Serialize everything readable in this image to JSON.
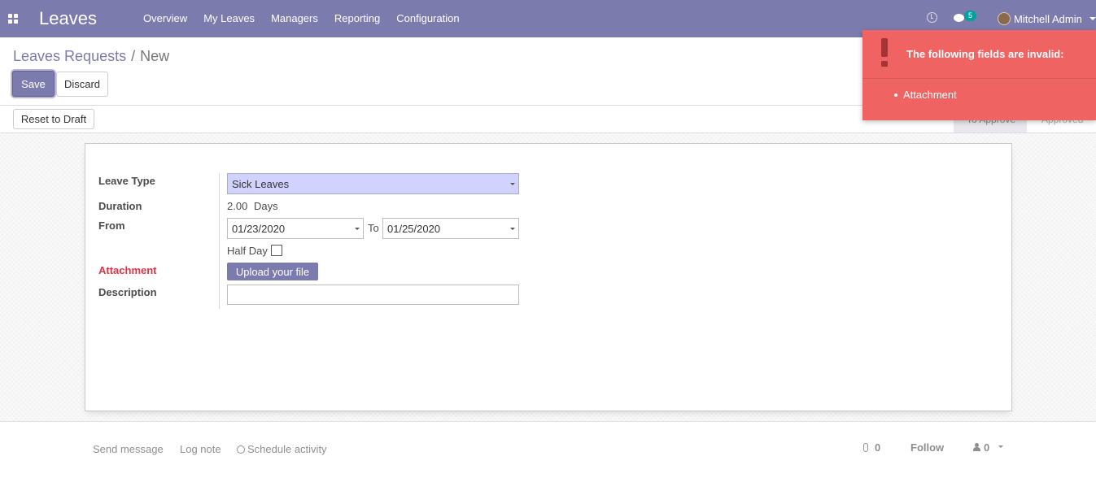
{
  "navbar": {
    "brand": "Leaves",
    "menu": [
      "Overview",
      "My Leaves",
      "Managers",
      "Reporting",
      "Configuration"
    ],
    "chat_count": "5",
    "user_name": "Mitchell Admin"
  },
  "breadcrumb": {
    "parent": "Leaves Requests",
    "separator": "/",
    "current": "New"
  },
  "buttons": {
    "save": "Save",
    "discard": "Discard",
    "reset_to_draft": "Reset to Draft",
    "upload": "Upload your file"
  },
  "statusbar": {
    "stages": [
      "To Approve",
      "Approved"
    ]
  },
  "form": {
    "leave_type_label": "Leave Type",
    "leave_type_value": "Sick Leaves",
    "duration_label": "Duration",
    "duration_value": "2.00",
    "duration_unit": "Days",
    "from_label": "From",
    "from_value": "01/23/2020",
    "to_label": "To",
    "to_value": "01/25/2020",
    "half_day_label": "Half Day",
    "attachment_label": "Attachment",
    "description_label": "Description",
    "description_value": ""
  },
  "chatter": {
    "send_message": "Send message",
    "log_note": "Log note",
    "schedule_activity": "Schedule activity",
    "attachments_count": "0",
    "follow": "Follow",
    "followers_count": "0"
  },
  "notification": {
    "title": "The following fields are invalid:",
    "items": [
      "Attachment"
    ]
  },
  "colors": {
    "brand": "#7c7bad",
    "invalid": "#dc3545",
    "notification": "#f06363",
    "invalid_fill": "#d2d2ff",
    "chat_badge": "#00a09d"
  }
}
